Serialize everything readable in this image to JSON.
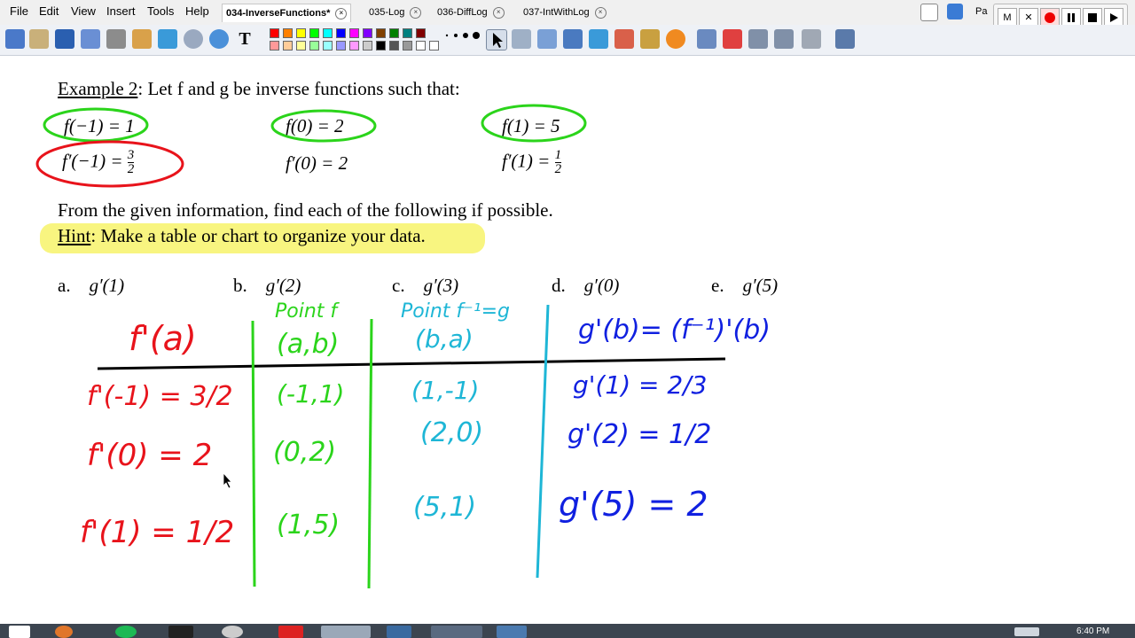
{
  "menu": [
    "File",
    "Edit",
    "View",
    "Insert",
    "Tools",
    "Help"
  ],
  "tabs": [
    {
      "label": "034-InverseFunctions*",
      "active": true
    },
    {
      "label": "035-Log",
      "active": false
    },
    {
      "label": "036-DiffLog",
      "active": false
    },
    {
      "label": "037-IntWithLog",
      "active": false
    }
  ],
  "page_label": "Pa",
  "recorder": {
    "m": "M",
    "x": "✕"
  },
  "doc": {
    "example_title": "Example 2",
    "intro": ": Let f and g be inverse functions such that:",
    "given": [
      {
        "lhs": "f(−1) = 1"
      },
      {
        "lhs": "f(0) = 2"
      },
      {
        "lhs": "f(1) = 5"
      }
    ],
    "derivs": [
      {
        "lhs": "f′(−1) =",
        "num": "3",
        "den": "2"
      },
      {
        "lhs": "f′(0) = 2",
        "num": "",
        "den": ""
      },
      {
        "lhs": "f′(1) =",
        "num": "1",
        "den": "2"
      }
    ],
    "instructions": "From the given information, find each of the following if possible.",
    "hint_word": "Hint",
    "hint_text": ":  Make a table or chart to organize your data.",
    "parts": [
      {
        "letter": "a.",
        "expr": "g′(1)"
      },
      {
        "letter": "b.",
        "expr": "g′(2)"
      },
      {
        "letter": "c.",
        "expr": "g′(3)"
      },
      {
        "letter": "d.",
        "expr": "g′(0)"
      },
      {
        "letter": "e.",
        "expr": "g′(5)"
      }
    ]
  },
  "handwriting": {
    "col1_header": "f'(a)",
    "col2_title": "Point f",
    "col2_header": "(a,b)",
    "col3_title": "Point f⁻¹=g",
    "col3_header": "(b,a)",
    "col4_header": "g'(b)= (f⁻¹)'(b)",
    "col1_rows": [
      "f'(-1) = 3/2",
      "f'(0) = 2",
      "f'(1) = 1/2"
    ],
    "col2_rows": [
      "(-1,1)",
      "(0,2)",
      "(1,5)"
    ],
    "col3_rows": [
      "(1,-1)",
      "(2,0)",
      "(5,1)"
    ],
    "col4_rows": [
      "g'(1) = 2/3",
      "g'(2) = 1/2",
      "g'(5) = 2"
    ]
  },
  "colors": {
    "red": "#e8131b",
    "green": "#2bd41b",
    "cyan": "#1eb6d6",
    "blue": "#1020e0",
    "highlight": "#f7f36a"
  },
  "clock": "6:40 PM"
}
